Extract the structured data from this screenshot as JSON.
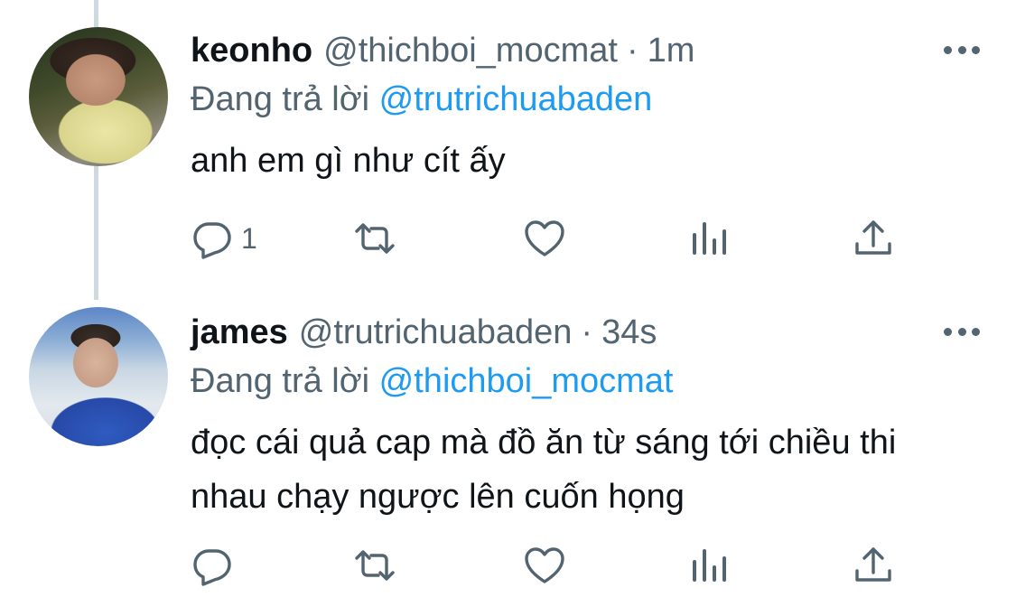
{
  "tweets": [
    {
      "name": "keonho",
      "handle": "@thichboi_mocmat",
      "separator": "·",
      "time": "1m",
      "replying_prefix": "Đang trả lời",
      "replying_to": "@trutrichuabaden",
      "text": "anh em gì như cít ấy",
      "reply_count": "1"
    },
    {
      "name": "james",
      "handle": "@trutrichuabaden",
      "separator": "·",
      "time": "34s",
      "replying_prefix": "Đang trả lời",
      "replying_to": "@thichboi_mocmat",
      "text": "đọc cái quả cap mà đồ ăn từ sáng tới chiều thi nhau chạy ngược lên cuốn họng",
      "reply_count": ""
    }
  ],
  "icons": {
    "reply": "reply-icon",
    "retweet": "retweet-icon",
    "like": "heart-icon",
    "views": "analytics-icon",
    "share": "share-icon",
    "more": "more-icon"
  },
  "colors": {
    "text": "#0f1419",
    "secondary": "#536471",
    "mention": "#1d9bf0",
    "thread_line": "#cfd9de"
  }
}
